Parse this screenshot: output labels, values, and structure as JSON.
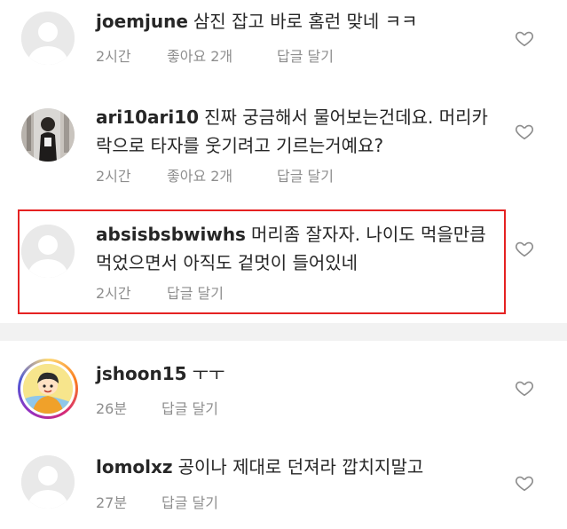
{
  "colors": {
    "highlight_border": "#e52222",
    "meta_text": "#8e8e8e",
    "separator": "#f2f2f2"
  },
  "comments": [
    {
      "username": "joemjune",
      "text": "삼진 잡고 바로 홈런 맞네 ㅋㅋ",
      "time": "2시간",
      "likes": "좋아요 2개",
      "reply": "답글 달기",
      "avatar": "default-avatar",
      "heart": "heart-outline-icon"
    },
    {
      "username": "ari10ari10",
      "text": "진짜 궁금해서 물어보는건데요. 머리카락으로 타자를 웃기려고 기르는거예요?",
      "time": "2시간",
      "likes": "좋아요 2개",
      "reply": "답글 달기",
      "avatar": "photo-avatar",
      "heart": "heart-outline-icon"
    },
    {
      "username": "absisbsbwiwhs",
      "text": "머리좀 잘자자. 나이도 먹을만큼 먹었으면서 아직도 겉멋이 들어있네",
      "time": "2시간",
      "reply": "답글 달기",
      "avatar": "default-avatar",
      "heart": "heart-outline-icon",
      "highlighted": true
    },
    {
      "username": "jshoon15",
      "text": "ㅜㅜ",
      "time": "26분",
      "reply": "답글 달기",
      "avatar": "cartoon-avatar-with-story-ring",
      "heart": "heart-outline-icon"
    },
    {
      "username": "lomolxz",
      "text": "공이나 제대로 던져라 깝치지말고",
      "time": "27분",
      "reply": "답글 달기",
      "avatar": "default-avatar",
      "heart": "heart-outline-icon"
    }
  ]
}
